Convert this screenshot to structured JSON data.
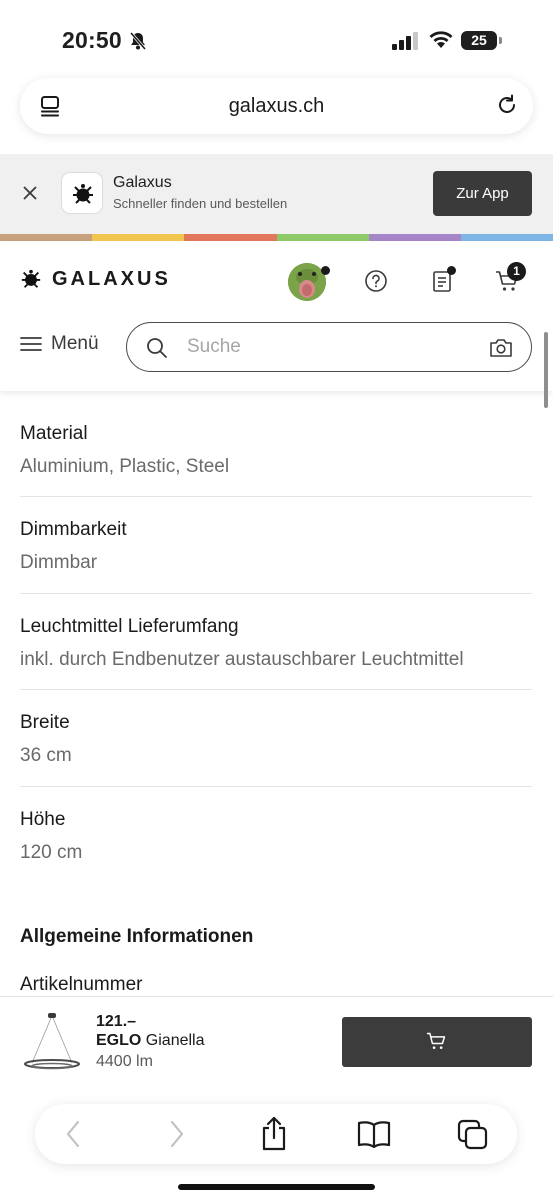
{
  "status": {
    "time": "20:50",
    "battery": "25"
  },
  "browser": {
    "url": "galaxus.ch"
  },
  "app_banner": {
    "title": "Galaxus",
    "subtitle": "Schneller finden und bestellen",
    "button": "Zur App"
  },
  "colors": {
    "stripe": [
      "#c7a27c",
      "#f0c64e",
      "#e2775b",
      "#8ecb68",
      "#a785c9",
      "#7fb6e8"
    ],
    "dark_button": "#3c3c3c"
  },
  "header": {
    "brand": "GALAXUS",
    "cart_count": "1",
    "menu_label": "Menü",
    "search_placeholder": "Suche"
  },
  "specs": [
    {
      "label": "Material",
      "value": "Aluminium, Plastic, Steel"
    },
    {
      "label": "Dimmbarkeit",
      "value": "Dimmbar"
    },
    {
      "label": "Leuchtmittel Lieferumfang",
      "value": "inkl. durch Endbenutzer austauschbarer Leuchtmittel"
    },
    {
      "label": "Breite",
      "value": "36 cm"
    },
    {
      "label": "Höhe",
      "value": "120 cm"
    }
  ],
  "general": {
    "title": "Allgemeine Informationen",
    "first_label": "Artikelnummer"
  },
  "product_bar": {
    "price": "121.–",
    "brand": "EGLO",
    "name": "Gianella",
    "lumen": "4400 lm"
  },
  "icons": {
    "status": [
      "bell-off-icon",
      "signal-icon",
      "wifi-icon",
      "battery-icon"
    ],
    "url_bar": [
      "tab-overview-icon",
      "reload-icon"
    ],
    "header": [
      "galaxus-logo-icon",
      "help-icon",
      "wishlist-icon",
      "cart-icon",
      "hamburger-icon",
      "search-icon",
      "camera-icon"
    ],
    "toolbar": [
      "back-icon",
      "forward-icon",
      "share-icon",
      "bookmarks-icon",
      "tabs-icon"
    ]
  }
}
